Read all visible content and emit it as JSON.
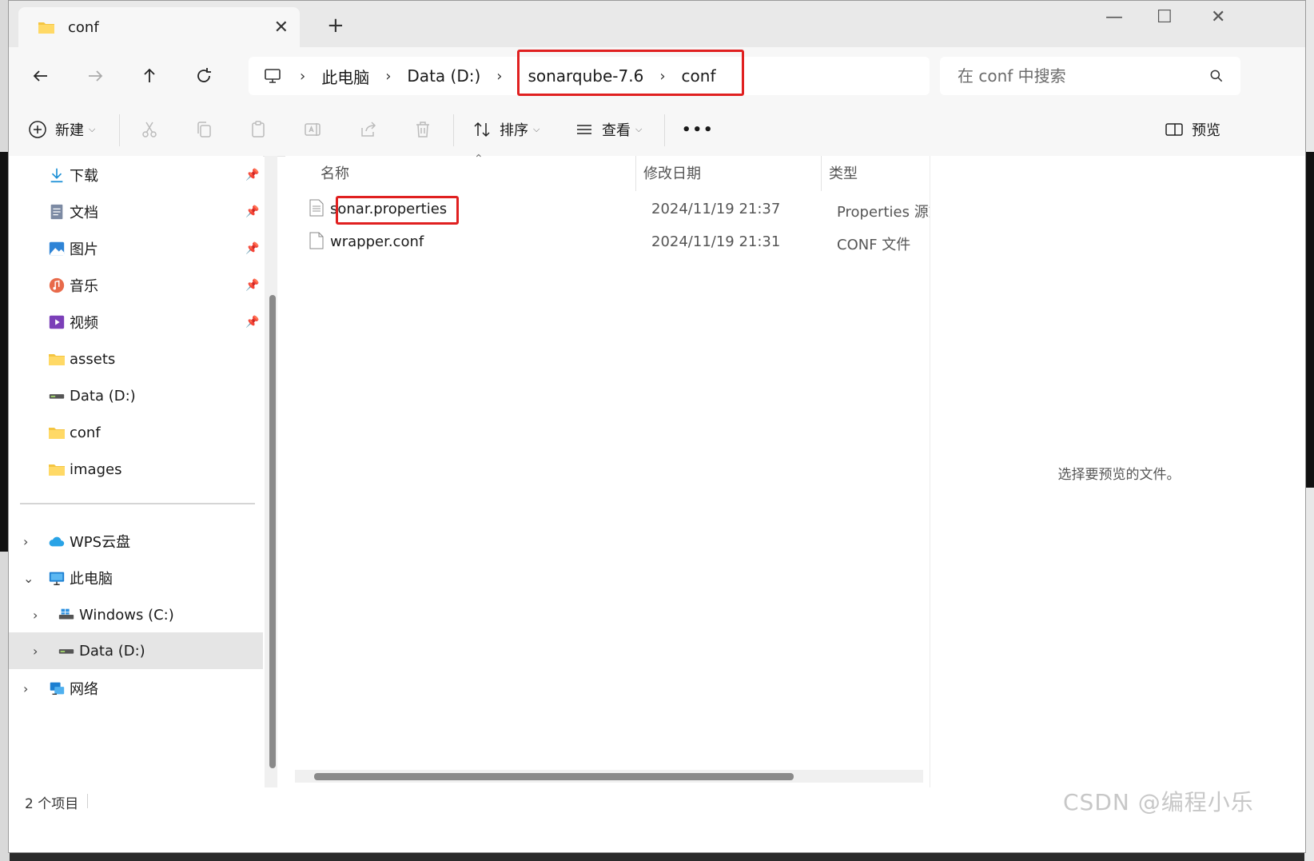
{
  "tab": {
    "title": "conf",
    "close": "✕",
    "new_tab": "+"
  },
  "window_controls": {
    "minimize": "—",
    "maximize": "☐",
    "close": "✕"
  },
  "address": {
    "segments": [
      "此电脑",
      "Data (D:)",
      "sonarqube-7.6",
      "conf"
    ],
    "separator": "›"
  },
  "search": {
    "placeholder": "在 conf 中搜索"
  },
  "toolbar": {
    "new_label": "新建",
    "sort_label": "排序",
    "view_label": "查看",
    "more_label": "•••",
    "preview_label": "预览"
  },
  "sidebar": {
    "quick": [
      {
        "label": "下载",
        "icon": "download-icon",
        "pinned": true
      },
      {
        "label": "文档",
        "icon": "document-icon",
        "pinned": true
      },
      {
        "label": "图片",
        "icon": "picture-icon",
        "pinned": true
      },
      {
        "label": "音乐",
        "icon": "music-icon",
        "pinned": true
      },
      {
        "label": "视频",
        "icon": "video-icon",
        "pinned": true
      },
      {
        "label": "assets",
        "icon": "folder-icon",
        "pinned": false
      },
      {
        "label": "Data (D:)",
        "icon": "drive-icon",
        "pinned": false
      },
      {
        "label": "conf",
        "icon": "folder-icon",
        "pinned": false
      },
      {
        "label": "images",
        "icon": "folder-icon",
        "pinned": false
      }
    ],
    "tree": [
      {
        "label": "WPS云盘",
        "icon": "cloud-icon",
        "expander": "›"
      },
      {
        "label": "此电脑",
        "icon": "computer-icon",
        "expander": "⌄"
      },
      {
        "label": "Windows (C:)",
        "icon": "windows-drive-icon",
        "expander": "›"
      },
      {
        "label": "Data (D:)",
        "icon": "drive-icon",
        "expander": "›",
        "selected": true
      },
      {
        "label": "网络",
        "icon": "network-icon",
        "expander": "›"
      }
    ]
  },
  "filelist": {
    "columns": {
      "name": "名称",
      "date": "修改日期",
      "type": "类型"
    },
    "rows": [
      {
        "name": "sonar.properties",
        "date": "2024/11/19 21:37",
        "type": "Properties 源文"
      },
      {
        "name": "wrapper.conf",
        "date": "2024/11/19 21:31",
        "type": "CONF 文件"
      }
    ]
  },
  "preview": {
    "message": "选择要预览的文件。"
  },
  "status": {
    "count": "2 个项目"
  },
  "watermark": "CSDN @编程小乐",
  "colors": {
    "highlight": "#e02020",
    "folder": "#f4c542"
  }
}
